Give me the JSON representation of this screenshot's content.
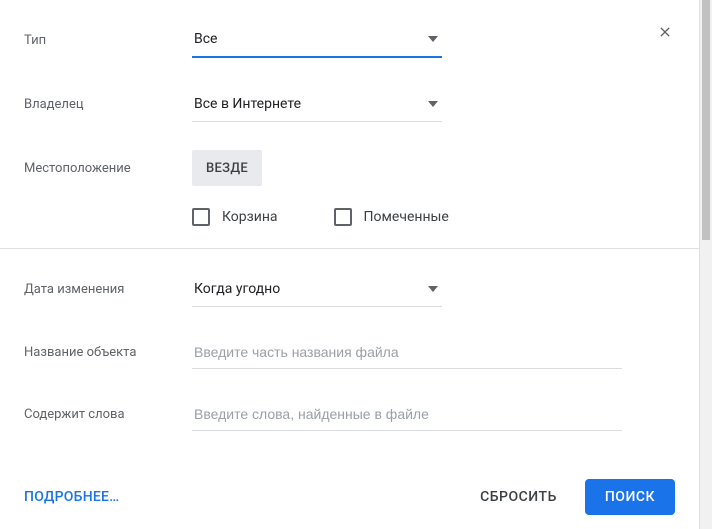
{
  "fields": {
    "type": {
      "label": "Тип",
      "value": "Все"
    },
    "owner": {
      "label": "Владелец",
      "value": "Все в Интернете"
    },
    "location": {
      "label": "Местоположение",
      "chip": "ВЕЗДЕ"
    },
    "trash": {
      "label": "Корзина"
    },
    "starred": {
      "label": "Помеченные"
    },
    "modified": {
      "label": "Дата изменения",
      "value": "Когда угодно"
    },
    "name": {
      "label": "Название объекта",
      "placeholder": "Введите часть названия файла"
    },
    "words": {
      "label": "Содержит слова",
      "placeholder": "Введите слова, найденные в файле"
    }
  },
  "footer": {
    "more": "ПОДРОБНЕЕ…",
    "reset": "СБРОСИТЬ",
    "search": "ПОИСК"
  }
}
